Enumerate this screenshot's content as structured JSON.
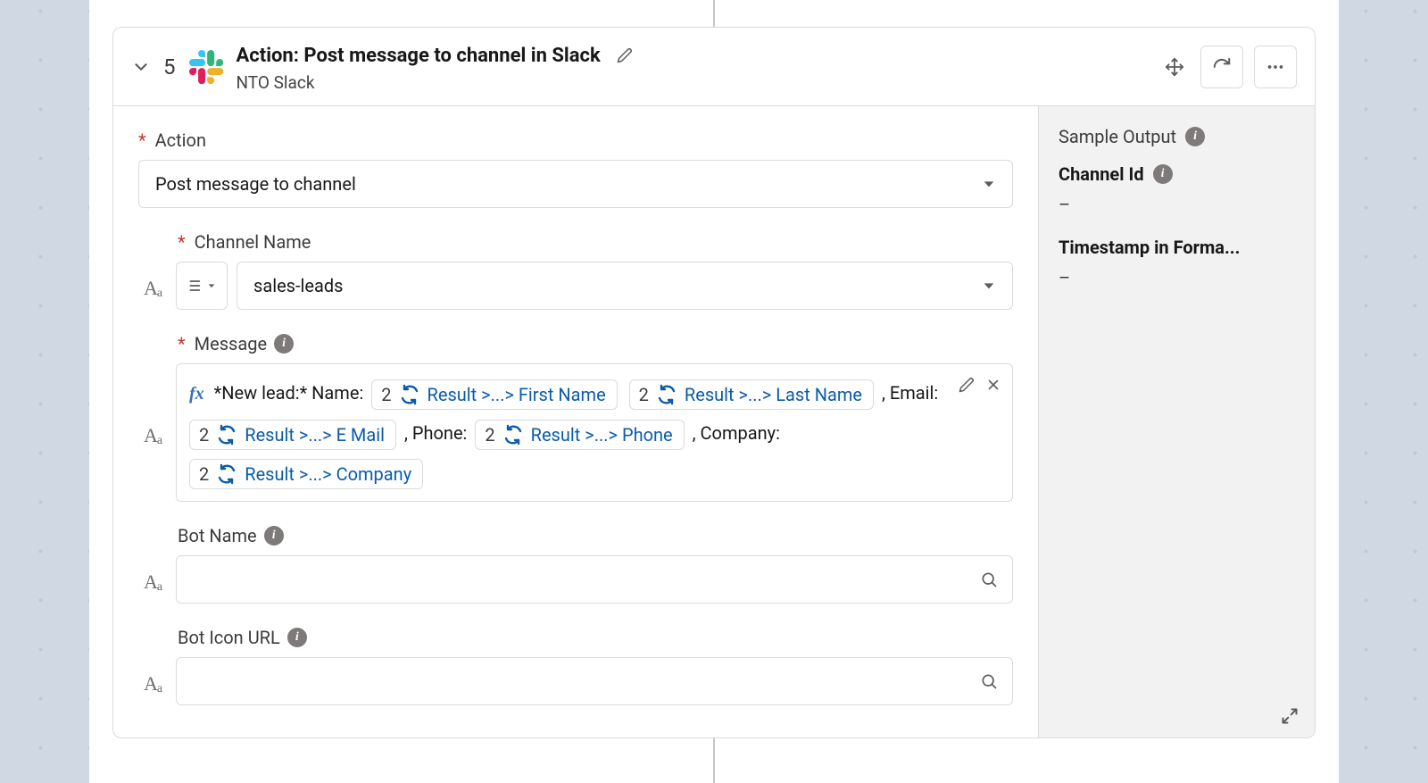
{
  "header": {
    "step_number": "5",
    "title": "Action: Post message to channel in Slack",
    "subtitle": "NTO Slack"
  },
  "form": {
    "action": {
      "label": "Action",
      "value": "Post message to channel"
    },
    "channel_name": {
      "label": "Channel Name",
      "value": "sales-leads"
    },
    "message": {
      "label": "Message",
      "prefix": "*New lead:* Name:",
      "sep_email": ", Email:",
      "sep_phone": ", Phone:",
      "sep_company": ", Company:",
      "pills": [
        {
          "num": "2",
          "label": "Result >...> First Name"
        },
        {
          "num": "2",
          "label": "Result >...> Last Name"
        },
        {
          "num": "2",
          "label": "Result >...> E Mail"
        },
        {
          "num": "2",
          "label": "Result >...> Phone"
        },
        {
          "num": "2",
          "label": "Result >...> Company"
        }
      ]
    },
    "bot_name": {
      "label": "Bot Name",
      "value": ""
    },
    "bot_icon_url": {
      "label": "Bot Icon URL",
      "value": ""
    }
  },
  "sample": {
    "heading": "Sample Output",
    "fields": [
      {
        "label": "Channel Id",
        "value": "–",
        "info": true
      },
      {
        "label": "Timestamp in Forma...",
        "value": "–",
        "info": false
      }
    ]
  }
}
